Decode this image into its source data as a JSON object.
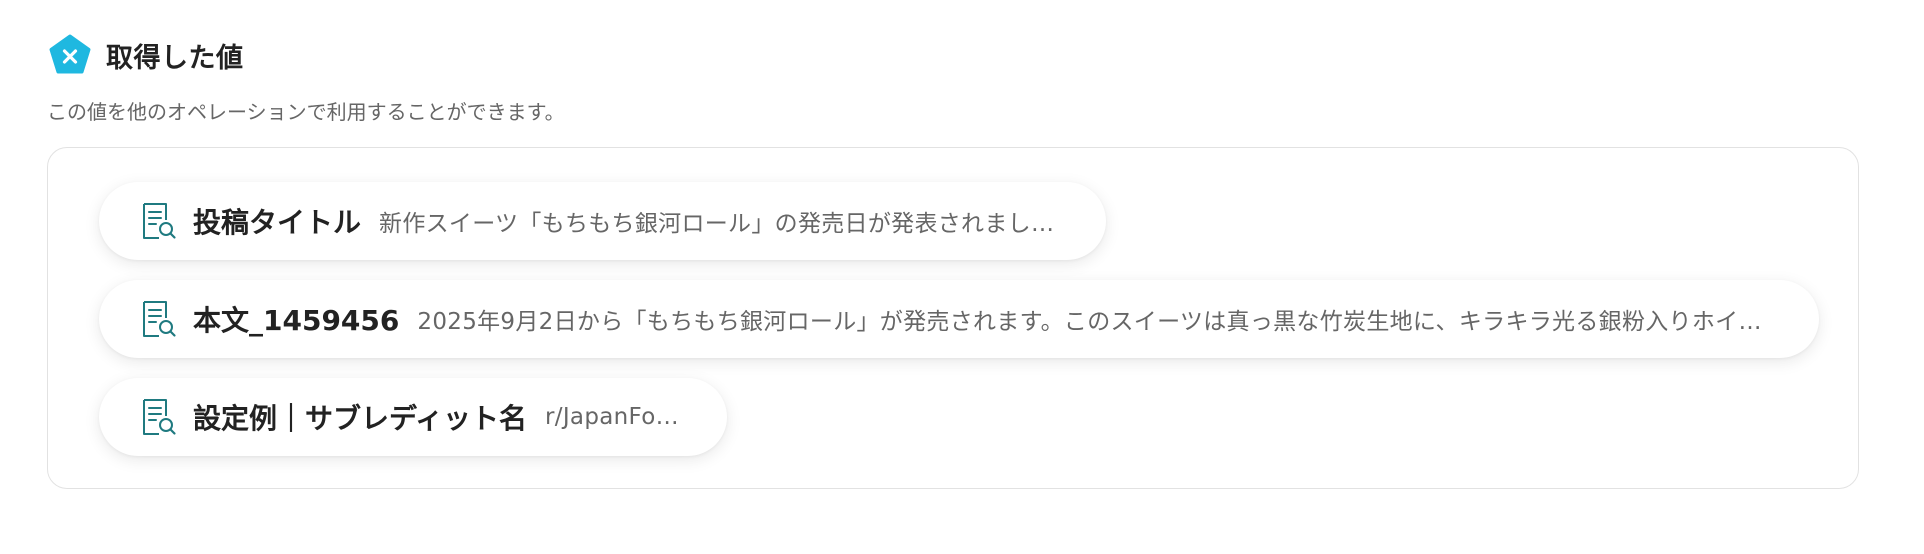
{
  "header": {
    "icon": "x-pentagon-icon",
    "title": "取得した値",
    "subtitle": "この値を他のオペレーションで利用することができます。",
    "accent_color": "#1fb8e0"
  },
  "fields": [
    {
      "icon": "document-search-icon",
      "key": "投稿タイトル",
      "value": "新作スイーツ「もちもち銀河ロール」の発売日が発表されました！"
    },
    {
      "icon": "document-search-icon",
      "key": "本文_1459456",
      "value": "2025年9月2日から「もちもち銀河ロール」が発売されます。このスイーツは真っ黒な竹炭生地に、キラキラ光る銀粉入りホイッ..."
    },
    {
      "icon": "document-search-icon",
      "key": "設定例｜サブレディット名",
      "value": "r/JapanFood"
    }
  ],
  "icon_color": "#1f7a80"
}
